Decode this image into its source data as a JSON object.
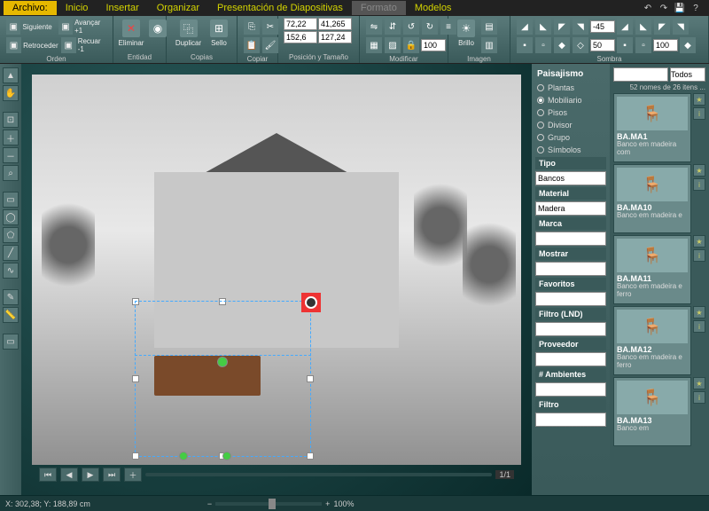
{
  "menu": {
    "archivo": "Archivo:",
    "items": [
      "Inicio",
      "Insertar",
      "Organizar",
      "Presentación de Diapositivas",
      "Formato",
      "Modelos"
    ],
    "active_index": 4
  },
  "ribbon": {
    "orden": {
      "label": "Orden",
      "siguiente": "Siguiente",
      "avancar": "Avançar +1",
      "retroceder": "Retroceder",
      "recuar": "Recuar -1"
    },
    "entidad": {
      "label": "Entidad",
      "eliminar": "Eliminar"
    },
    "copias": {
      "label": "Copias",
      "duplicar": "Duplicar",
      "sello": "Sello"
    },
    "copiar": {
      "label": "Copiar"
    },
    "posicion": {
      "label": "Posición y Tamaño",
      "x": "72,22",
      "y": "41,265",
      "w": "152,6",
      "h": "127,24"
    },
    "modificar": {
      "label": "Modificar"
    },
    "imagen": {
      "label": "Imagen",
      "brillo": "Brillo",
      "val": "100"
    },
    "sombra": {
      "label": "Sombra",
      "ang": "-45",
      "dist": "50",
      "blur": "100"
    }
  },
  "sidebar_filters": {
    "header": "Paisajismo",
    "categories": [
      "Plantas",
      "Mobiliario",
      "Pisos",
      "Divisor",
      "Grupo",
      "Símbolos"
    ],
    "selected_index": 1,
    "tipo_label": "Tipo",
    "tipo_value": "Bancos",
    "material_label": "Material",
    "material_value": "Madera",
    "marca_label": "Marca",
    "mostrar_label": "Mostrar",
    "favoritos_label": "Favoritos",
    "filtro_lnd_label": "Filtro (LND)",
    "proveedor_label": "Proveedor",
    "ambientes_label": "# Ambientes",
    "filtro_label": "Filtro"
  },
  "catalog": {
    "search_placeholder": "",
    "scope": "Todos",
    "count_text": "52 nomes de 26 itens ...",
    "items": [
      {
        "code": "BA.MA1",
        "desc": "Banco em madeira com"
      },
      {
        "code": "BA.MA10",
        "desc": "Banco em madeira e"
      },
      {
        "code": "BA.MA11",
        "desc": "Banco em madeira e ferro"
      },
      {
        "code": "BA.MA12",
        "desc": "Banco em madeira e ferro"
      },
      {
        "code": "BA.MA13",
        "desc": "Banco em"
      }
    ]
  },
  "nav": {
    "page": "1/1"
  },
  "status": {
    "coords": "X: 302,38; Y: 188,89 cm",
    "zoom": "100%"
  }
}
